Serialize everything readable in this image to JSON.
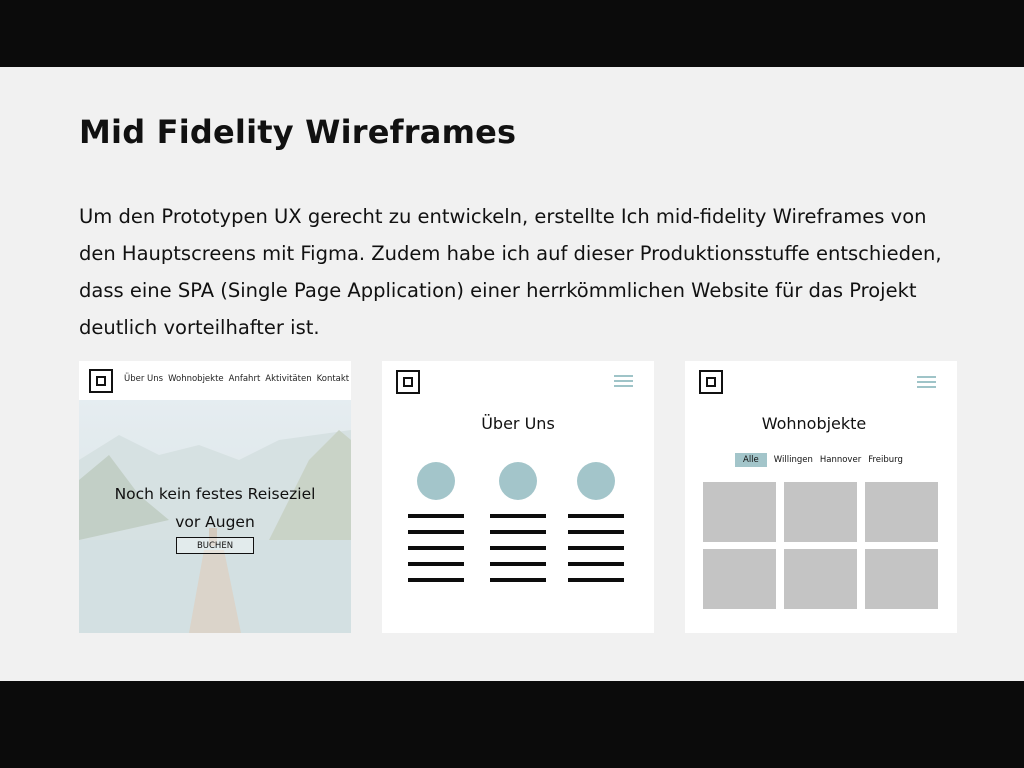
{
  "slide": {
    "title": "Mid Fidelity Wireframes",
    "body": "Um den Prototypen UX gerecht zu entwickeln, erstellte Ich mid-fidelity Wireframes von den Hauptscreens mit Figma. Zudem habe ich auf dieser Produktionsstuffe entschieden, dass eine SPA (Single Page Application) einer herrkömmlichen Website für das Projekt deutlich vorteilhafter ist."
  },
  "wireframe_home": {
    "nav": [
      "Über Uns",
      "Wohnobjekte",
      "Anfahrt",
      "Aktivitäten",
      "Kontakt"
    ],
    "headline_line1": "Noch kein festes Reiseziel",
    "headline_line2": "vor Augen",
    "cta_label": "BUCHEN"
  },
  "wireframe_about": {
    "title": "Über Uns"
  },
  "wireframe_listings": {
    "title": "Wohnobjekte",
    "filters": [
      "Alle",
      "Willingen",
      "Hannover",
      "Freiburg"
    ],
    "active_filter": "Alle"
  },
  "colors": {
    "accent": "#a3c5ca",
    "frame_bg": "#f1f1f1",
    "letterbox": "#0b0b0b",
    "placeholder": "#c4c4c4"
  }
}
